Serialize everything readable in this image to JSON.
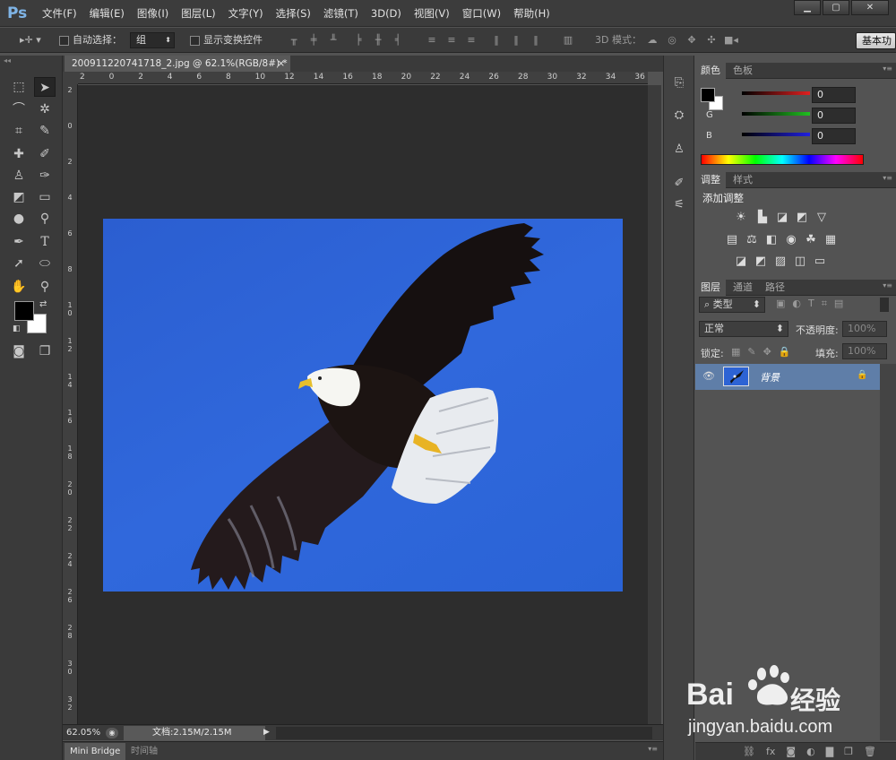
{
  "app": {
    "logo": "Ps"
  },
  "menu": [
    "文件(F)",
    "编辑(E)",
    "图像(I)",
    "图层(L)",
    "文字(Y)",
    "选择(S)",
    "滤镜(T)",
    "3D(D)",
    "视图(V)",
    "窗口(W)",
    "帮助(H)"
  ],
  "window_buttons": {
    "minimize": "▁",
    "maximize": "▢",
    "close": "✕"
  },
  "options_bar": {
    "auto_select_label": "自动选择：",
    "auto_select_value": "组",
    "show_transform_label": "显示变换控件",
    "mode_3d_label": "3D 模式：",
    "workspace_label": "基本功"
  },
  "document": {
    "tab_title": "200911220741718_2.jpg @ 62.1%(RGB/8#) *",
    "tab_close": "×",
    "ruler_h": [
      "2",
      "0",
      "2",
      "4",
      "6",
      "8",
      "10",
      "12",
      "14",
      "16",
      "18",
      "20",
      "22",
      "24",
      "26",
      "28",
      "30",
      "32",
      "34",
      "36"
    ],
    "ruler_v": [
      "2",
      "0",
      "2",
      "4",
      "6",
      "8",
      "1 0",
      "1 2",
      "1 4",
      "1 6",
      "1 8",
      "2 0",
      "2 2",
      "2 4",
      "2 6",
      "2 8",
      "3 0",
      "3 2"
    ],
    "zoom": "62.05%",
    "doc_info": "文档:2.15M/2.15M"
  },
  "bottom_tabs": [
    "Mini Bridge",
    "时间轴"
  ],
  "color_panel": {
    "tabs": [
      "颜色",
      "色板"
    ],
    "channels": [
      {
        "label": "R",
        "value": "0",
        "color": "#e02020"
      },
      {
        "label": "G",
        "value": "0",
        "color": "#20c020"
      },
      {
        "label": "B",
        "value": "0",
        "color": "#2020e0"
      }
    ]
  },
  "adjust_panel": {
    "tabs": [
      "调整",
      "样式"
    ],
    "title": "添加调整"
  },
  "layers_panel": {
    "tabs": [
      "图层",
      "通道",
      "路径"
    ],
    "filter_type": "类型",
    "blend_mode": "正常",
    "opacity_label": "不透明度:",
    "opacity_value": "100%",
    "lock_label": "锁定:",
    "fill_label": "填充:",
    "fill_value": "100%",
    "layer_name": "背景"
  },
  "watermark": {
    "brand": "Bai",
    "brand2": "经验",
    "url": "jingyan.baidu.com"
  }
}
